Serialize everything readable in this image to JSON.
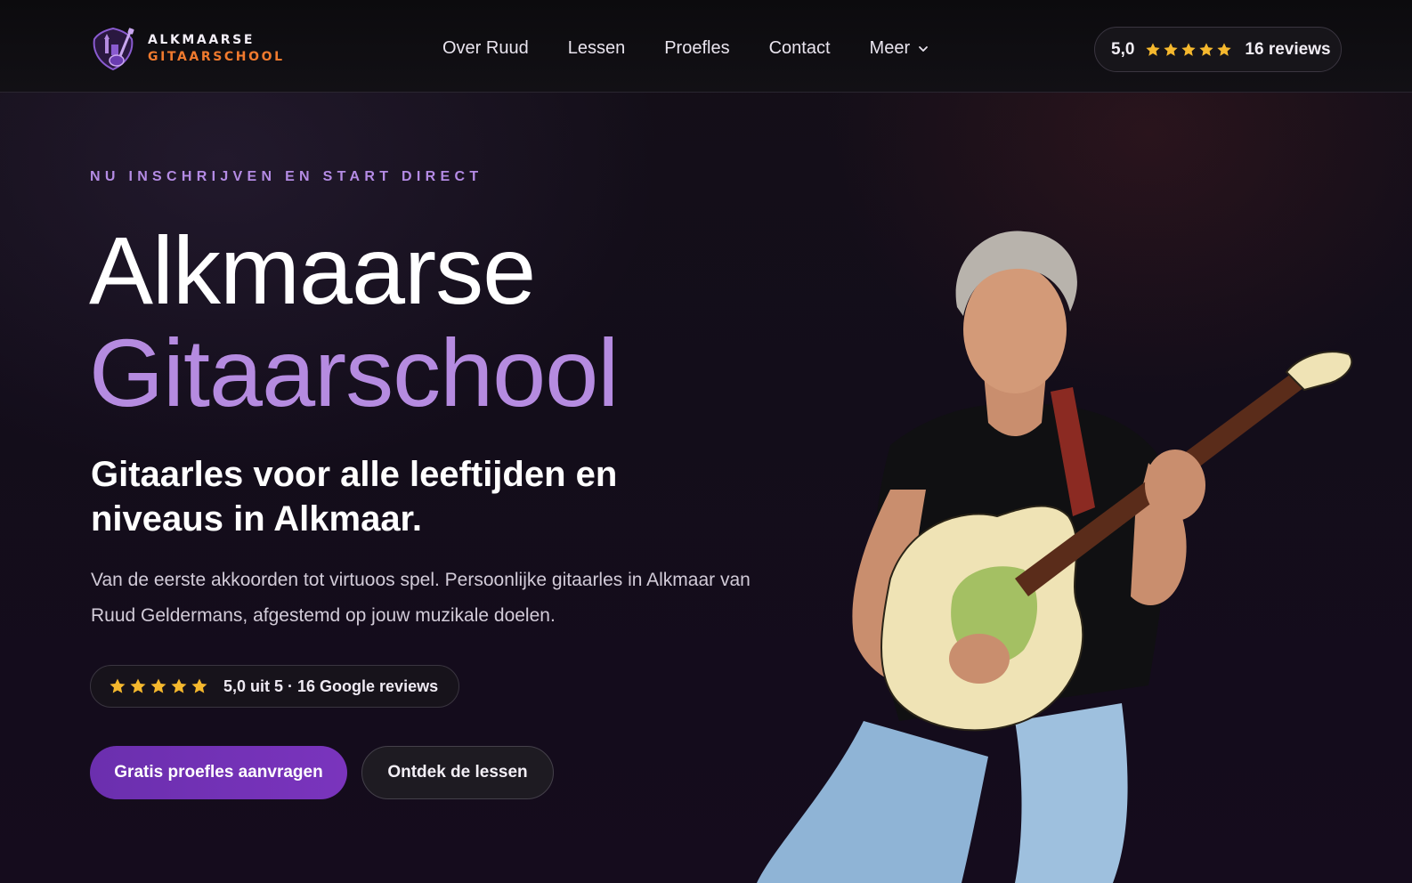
{
  "header": {
    "logo": {
      "line1": "ALKMAARSE",
      "line2": "GITAARSCHOOL"
    },
    "nav": [
      {
        "label": "Over Ruud"
      },
      {
        "label": "Lessen"
      },
      {
        "label": "Proefles"
      },
      {
        "label": "Contact"
      },
      {
        "label": "Meer"
      }
    ],
    "rating": {
      "score": "5,0",
      "stars": 5,
      "reviews": "16 reviews"
    }
  },
  "hero": {
    "eyebrow": "NU INSCHRIJVEN EN START DIRECT",
    "title_line1": "Alkmaarse",
    "title_line2": "Gitaarschool",
    "subtitle": "Gitaarles voor alle leeftijden en niveaus in Alkmaar.",
    "lede": "Van de eerste akkoorden tot virtuoos spel. Persoonlijke gitaarles in Alkmaar van Ruud Geldermans, afgestemd op jouw muzikale doelen.",
    "review_badge": {
      "stars": 5,
      "text": "5,0 uit 5 · 16 Google reviews"
    },
    "primary_cta": "Gratis proefles aanvragen",
    "secondary_cta": "Ontdek de lessen"
  },
  "colors": {
    "accent_purple": "#b58be0",
    "brand_orange": "#f07a2e",
    "star_gold": "#f5b82e",
    "button_purple": "#7a34bd"
  }
}
